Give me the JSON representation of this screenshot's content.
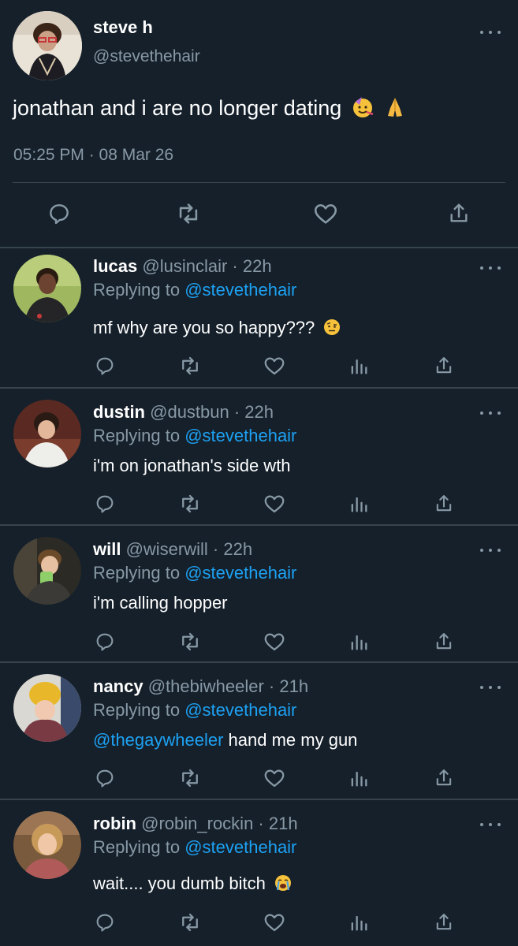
{
  "main_tweet": {
    "display_name": "steve h",
    "handle": "@stevethehair",
    "text": "jonathan and i are no longer dating",
    "emojis": [
      "partying-face",
      "folded-hands"
    ],
    "time": "05:25 PM · 08 Mar 26",
    "actions": [
      "reply-icon",
      "retweet-icon",
      "like-icon",
      "share-icon"
    ]
  },
  "replies": [
    {
      "name": "lucas",
      "handle": "@lusinclair · 22h",
      "replying_prefix": "Replying to",
      "replying_to": "@stevethehair",
      "text": "mf why are you so happy???",
      "emoji": "raised-eyebrow-face"
    },
    {
      "name": "dustin",
      "handle": "@dustbun · 22h",
      "replying_prefix": "Replying to",
      "replying_to": "@stevethehair",
      "text": "i'm on jonathan's side wth"
    },
    {
      "name": "will",
      "handle": "@wiserwill · 22h",
      "replying_prefix": "Replying to",
      "replying_to": "@stevethehair",
      "text": "i'm calling hopper"
    },
    {
      "name": "nancy",
      "handle": "@thebiwheeler · 21h",
      "replying_prefix": "Replying to",
      "replying_to": "@stevethehair",
      "text_mention": "@thegaywheeler",
      "text": " hand me my gun"
    },
    {
      "name": "robin",
      "handle": "@robin_rockin · 21h",
      "replying_prefix": "Replying to",
      "replying_to": "@stevethehair",
      "text": "wait.... you dumb bitch",
      "emoji": "loudly-crying-face"
    }
  ],
  "colors": {
    "background": "#15202b",
    "divider": "#38444d",
    "secondary_text": "#8899a6",
    "accent": "#1da1f2"
  }
}
